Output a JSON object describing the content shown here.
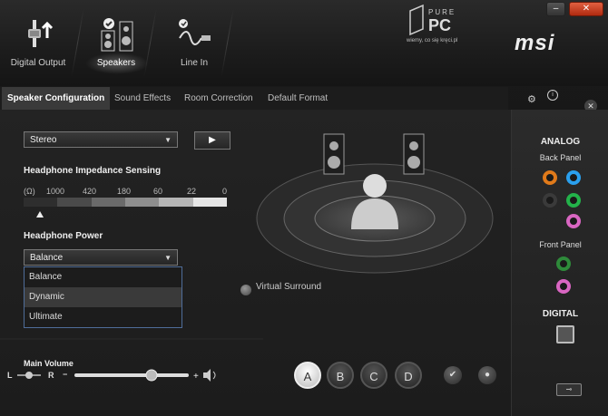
{
  "header": {
    "devices": [
      {
        "label": "Digital Output",
        "icon": "plug-arrow-icon"
      },
      {
        "label": "Speakers",
        "icon": "speaker-check-icon"
      },
      {
        "label": "Line In",
        "icon": "line-in-cable-icon"
      }
    ],
    "brand": "msi",
    "watermark_main": "PURE PC",
    "watermark_sub": "wiemy, co się kręci.pl"
  },
  "tabs": [
    "Speaker Configuration",
    "Sound Effects",
    "Room Correction",
    "Default Format"
  ],
  "speaker_config": {
    "mode_value": "Stereo",
    "impedance_title": "Headphone Impedance Sensing",
    "impedance_unit": "(Ω)",
    "impedance_ticks": [
      "1000",
      "420",
      "180",
      "60",
      "22",
      "0"
    ],
    "headphone_power_title": "Headphone Power",
    "power_value": "Balance",
    "power_options": [
      "Balance",
      "Dynamic",
      "Ultimate"
    ],
    "virtual_surround": "Virtual Surround"
  },
  "volume": {
    "title": "Main Volume",
    "left": "L",
    "right": "R",
    "minus": "−",
    "plus": "+"
  },
  "presets": [
    "A",
    "B",
    "C",
    "D"
  ],
  "right_panel": {
    "analog": "ANALOG",
    "back_panel": "Back Panel",
    "front_panel": "Front Panel",
    "digital": "DIGITAL"
  },
  "colors": {
    "jack_orange": "#e07a1a",
    "jack_blue": "#2aa0ee",
    "jack_black": "#3a3a3a",
    "jack_green": "#23b24a",
    "jack_pink": "#d966c2",
    "jack_front_green": "#2e8a3a"
  }
}
